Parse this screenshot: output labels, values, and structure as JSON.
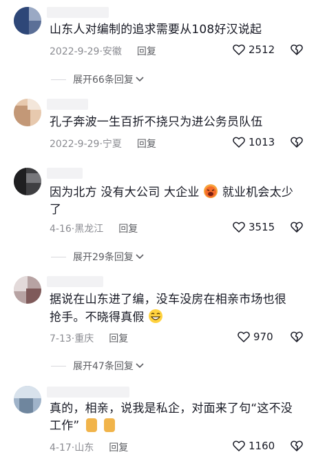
{
  "comments": [
    {
      "text": "山东人对编制的追求需要从108好汉说起",
      "date": "2022-9-29",
      "location": "安徽",
      "reply": "回复",
      "likes": "2512",
      "expand": "展开66条回复"
    },
    {
      "text": "孔子奔波一生百折不挠只为进公务员队伍",
      "date": "2022-9-29",
      "location": "宁夏",
      "reply": "回复",
      "likes": "1013"
    },
    {
      "text_a": "因为北方 没有大公司 大企业",
      "text_b": "就业机会太少了",
      "date": "4-16",
      "location": "黑龙江",
      "reply": "回复",
      "likes": "3515",
      "expand": "展开29条回复"
    },
    {
      "text": "据说在山东进了编，没车没房在相亲市场也很抢手。不晓得真假",
      "date": "7-13",
      "location": "重庆",
      "reply": "回复",
      "likes": "970",
      "expand": "展开47条回复"
    },
    {
      "text": "真的，相亲，说我是私企，对面来了句“这不没工作”",
      "date": "4-17",
      "location": "山东",
      "reply": "回复",
      "likes": "1160"
    }
  ],
  "meta_separator": "·",
  "icons": {
    "like": "heart-outline-icon",
    "dislike": "broken-heart-icon",
    "expand": "chevron-down-icon"
  },
  "colors": {
    "text": "#161823",
    "meta": "#8a8b91",
    "reply": "#5b5c61"
  }
}
